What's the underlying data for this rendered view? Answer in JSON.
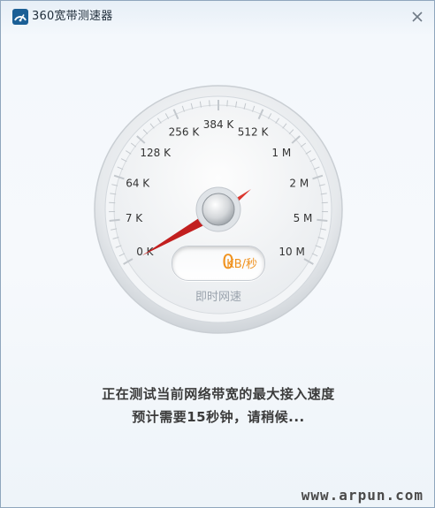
{
  "window": {
    "title": "360宽带测速器",
    "close_icon": "close-icon",
    "app_icon": "speedometer-app-icon"
  },
  "gauge": {
    "scale_labels": [
      "0 K",
      "7 K",
      "64 K",
      "128 K",
      "256 K",
      "384 K",
      "512 K",
      "1 M",
      "2 M",
      "5 M",
      "10 M"
    ],
    "needle_color": "#d62a2a",
    "speed_value": "0",
    "speed_unit": "KB/秒",
    "caption": "即时网速",
    "accent_color": "#f0921e"
  },
  "status": {
    "line1": "正在测试当前网络带宽的最大接入速度",
    "line2": "预计需要15秒钟，请稍候..."
  },
  "watermark": "www.arpun.com"
}
